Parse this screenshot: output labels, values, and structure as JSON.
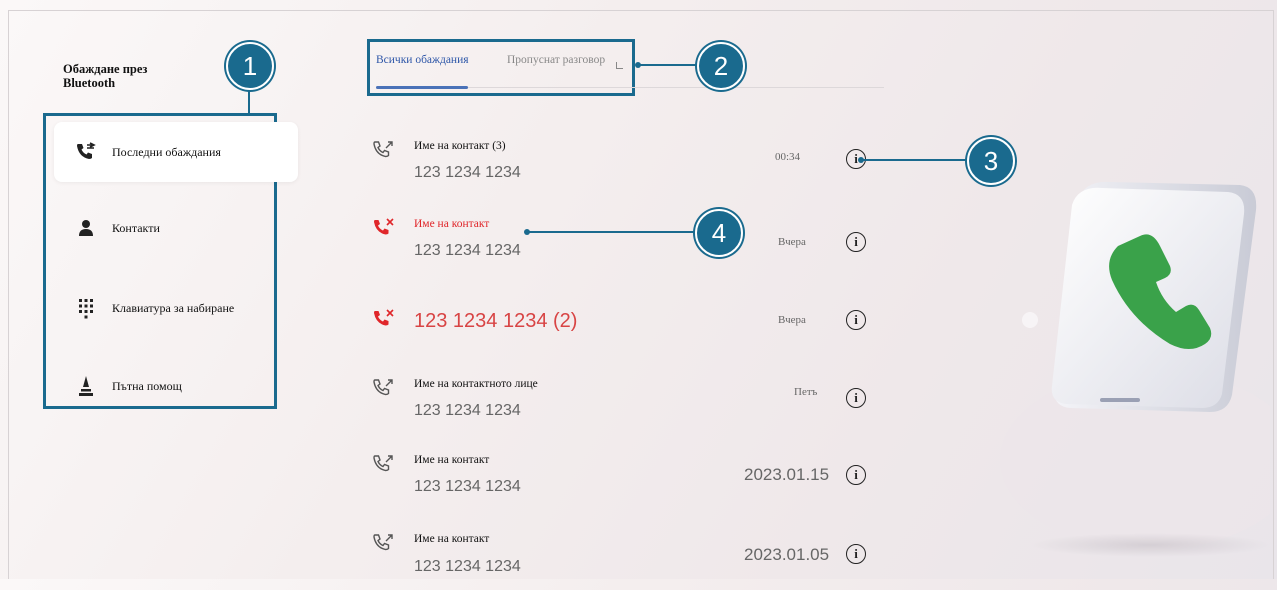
{
  "app": {
    "title_line1": "Обаждане през",
    "title_line2": "Bluetooth"
  },
  "nav": {
    "items": [
      {
        "label": "Последни обаждания",
        "icon": "recent-calls-icon",
        "active": true
      },
      {
        "label": "Контакти",
        "icon": "contact-person-icon",
        "active": false
      },
      {
        "label": "Клавиатура за набиране",
        "icon": "dialpad-icon",
        "active": false
      },
      {
        "label": "Пътна помощ",
        "icon": "road-assistance-icon",
        "active": false
      }
    ]
  },
  "tabs": {
    "all": "Всички обаждания",
    "missed": "Пропуснат разговор"
  },
  "calls": [
    {
      "name": "Име на контакт (3)",
      "number": "123 1234 1234",
      "time": "00:34",
      "type": "outgoing"
    },
    {
      "name": "Име на контакт",
      "number": "123 1234 1234",
      "time": "Вчера",
      "type": "missed"
    },
    {
      "number": "123 1234 1234  (2)",
      "time": "Вчера",
      "type": "missed"
    },
    {
      "name": "Име на контактното лице",
      "number": "123 1234 1234",
      "time": "Петъ",
      "type": "outgoing"
    },
    {
      "name": "Име на контакт",
      "number": "123 1234 1234",
      "time": "2023.01.15",
      "type": "outgoing"
    },
    {
      "name": "Име на контакт",
      "number": "123 1234 1234",
      "time": "2023.01.05",
      "type": "outgoing"
    }
  ],
  "callouts": [
    "1",
    "2",
    "3",
    "4"
  ],
  "colors": {
    "accent": "#1a6a8e",
    "missed": "#e0262a",
    "tab_active": "#2d56a8",
    "phone_green": "#3aa24a"
  }
}
